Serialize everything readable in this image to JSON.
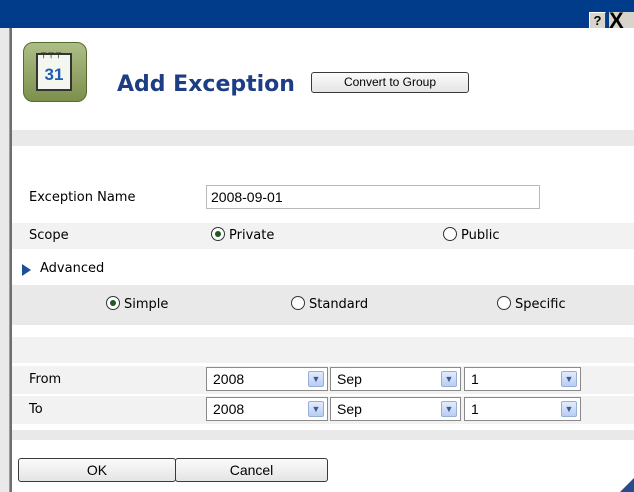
{
  "titlebar": {
    "help_label": "?",
    "close_label": "X"
  },
  "header": {
    "icon_day": "31",
    "title": "Add Exception",
    "convert_label": "Convert to Group"
  },
  "form": {
    "exception_name_label": "Exception Name",
    "exception_name_value": "2008-09-01",
    "scope_label": "Scope",
    "scope_private_label": "Private",
    "scope_public_label": "Public",
    "scope_selected": "Private",
    "advanced_label": "Advanced",
    "mode_simple_label": "Simple",
    "mode_standard_label": "Standard",
    "mode_specific_label": "Specific",
    "mode_selected": "Simple",
    "from_label": "From",
    "to_label": "To",
    "from": {
      "year": "2008",
      "month": "Sep",
      "day": "1"
    },
    "to": {
      "year": "2008",
      "month": "Sep",
      "day": "1"
    }
  },
  "footer": {
    "ok_label": "OK",
    "cancel_label": "Cancel"
  },
  "icons": {
    "dropdown": "chevron-down-icon",
    "advanced": "triangle-right-icon"
  },
  "colors": {
    "titlebar": "#003c8a",
    "title_text": "#1d3e84",
    "band": "#e9e9e9",
    "row": "#f2f2f2"
  }
}
